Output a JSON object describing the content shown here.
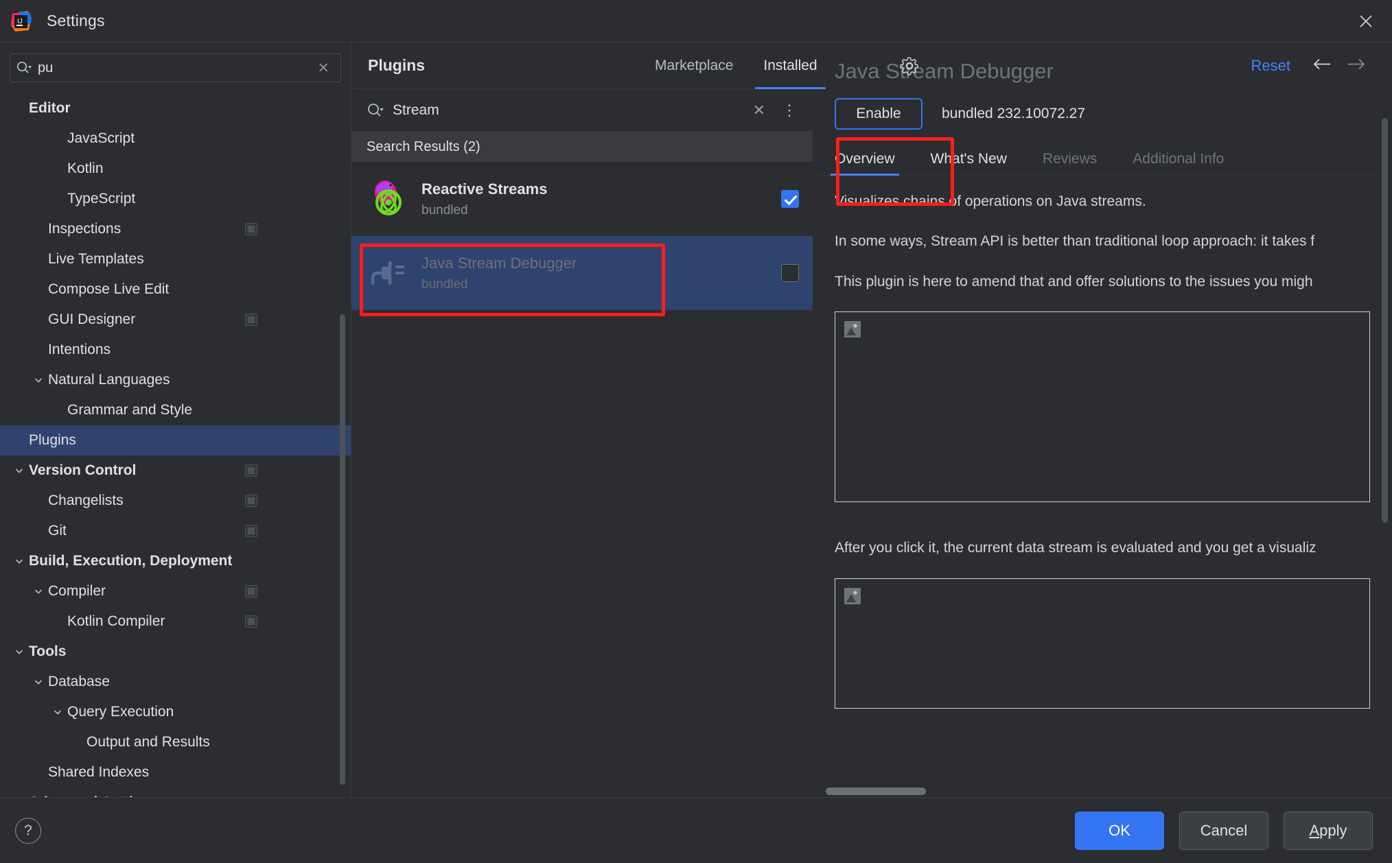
{
  "window": {
    "title": "Settings",
    "close_icon": "close-icon",
    "logo_icon": "intellij-idea-logo"
  },
  "settings_search": {
    "value": "pu",
    "placeholder": "",
    "search_icon": "search-icon",
    "clear_icon": "clear-icon"
  },
  "sidebar": {
    "items": [
      {
        "label": "Editor",
        "indent": 1,
        "bold": true,
        "arrow": "none",
        "badge": false,
        "selected": false
      },
      {
        "label": "JavaScript",
        "indent": 3,
        "bold": false,
        "arrow": "none",
        "badge": false,
        "selected": false
      },
      {
        "label": "Kotlin",
        "indent": 3,
        "bold": false,
        "arrow": "none",
        "badge": false,
        "selected": false
      },
      {
        "label": "TypeScript",
        "indent": 3,
        "bold": false,
        "arrow": "none",
        "badge": false,
        "selected": false
      },
      {
        "label": "Inspections",
        "indent": 2,
        "bold": false,
        "arrow": "none",
        "badge": true,
        "selected": false
      },
      {
        "label": "Live Templates",
        "indent": 2,
        "bold": false,
        "arrow": "none",
        "badge": false,
        "selected": false
      },
      {
        "label": "Compose Live Edit",
        "indent": 2,
        "bold": false,
        "arrow": "none",
        "badge": false,
        "selected": false
      },
      {
        "label": "GUI Designer",
        "indent": 2,
        "bold": false,
        "arrow": "none",
        "badge": true,
        "selected": false
      },
      {
        "label": "Intentions",
        "indent": 2,
        "bold": false,
        "arrow": "none",
        "badge": false,
        "selected": false
      },
      {
        "label": "Natural Languages",
        "indent": 2,
        "bold": false,
        "arrow": "down",
        "badge": false,
        "selected": false
      },
      {
        "label": "Grammar and Style",
        "indent": 3,
        "bold": false,
        "arrow": "none",
        "badge": false,
        "selected": false
      },
      {
        "label": "Plugins",
        "indent": 1,
        "bold": false,
        "arrow": "none",
        "badge": false,
        "selected": true
      },
      {
        "label": "Version Control",
        "indent": 1,
        "bold": true,
        "arrow": "down",
        "badge": true,
        "selected": false
      },
      {
        "label": "Changelists",
        "indent": 2,
        "bold": false,
        "arrow": "none",
        "badge": true,
        "selected": false
      },
      {
        "label": "Git",
        "indent": 2,
        "bold": false,
        "arrow": "none",
        "badge": true,
        "selected": false
      },
      {
        "label": "Build, Execution, Deployment",
        "indent": 1,
        "bold": true,
        "arrow": "down",
        "badge": false,
        "selected": false
      },
      {
        "label": "Compiler",
        "indent": 2,
        "bold": false,
        "arrow": "down",
        "badge": true,
        "selected": false
      },
      {
        "label": "Kotlin Compiler",
        "indent": 3,
        "bold": false,
        "arrow": "none",
        "badge": true,
        "selected": false
      },
      {
        "label": "Tools",
        "indent": 1,
        "bold": true,
        "arrow": "down",
        "badge": false,
        "selected": false
      },
      {
        "label": "Database",
        "indent": 2,
        "bold": false,
        "arrow": "down",
        "badge": false,
        "selected": false
      },
      {
        "label": "Query Execution",
        "indent": 3,
        "bold": false,
        "arrow": "down",
        "badge": false,
        "selected": false
      },
      {
        "label": "Output and Results",
        "indent": 4,
        "bold": false,
        "arrow": "none",
        "badge": false,
        "selected": false
      },
      {
        "label": "Shared Indexes",
        "indent": 2,
        "bold": false,
        "arrow": "none",
        "badge": false,
        "selected": false
      },
      {
        "label": "Advanced Settings",
        "indent": 1,
        "bold": true,
        "arrow": "none",
        "badge": false,
        "selected": false
      }
    ]
  },
  "plugins_panel": {
    "title": "Plugins",
    "tabs": [
      {
        "label": "Marketplace",
        "active": false
      },
      {
        "label": "Installed",
        "active": true
      }
    ],
    "gear_icon": "gear-icon",
    "reset_label": "Reset",
    "back_icon": "arrow-left-icon",
    "forward_icon": "arrow-right-icon",
    "search": {
      "value": "Stream",
      "search_icon": "search-icon",
      "clear_icon": "clear-icon",
      "more_icon": "more-options-icon"
    },
    "results_header": "Search Results (2)",
    "rows": [
      {
        "name": "Reactive Streams",
        "sub": "bundled",
        "checked": true,
        "selected": false,
        "disabled": false,
        "icon": "reactive-streams-icon"
      },
      {
        "name": "Java Stream Debugger",
        "sub": "bundled",
        "checked": false,
        "selected": true,
        "disabled": true,
        "icon": "plugin-plug-icon"
      }
    ]
  },
  "detail": {
    "title": "Java Stream Debugger",
    "enable_label": "Enable",
    "version_text": "bundled 232.10072.27",
    "tabs": [
      {
        "label": "Overview",
        "active": true,
        "dim": false
      },
      {
        "label": "What's New",
        "active": false,
        "dim": false
      },
      {
        "label": "Reviews",
        "active": false,
        "dim": true
      },
      {
        "label": "Additional Info",
        "active": false,
        "dim": true
      }
    ],
    "paragraphs": [
      "Visualizes chains of operations on Java streams.",
      "In some ways, Stream API is better than traditional loop approach: it takes f",
      "This plugin is here to amend that and offer solutions to the issues you migh"
    ],
    "paragraph_after_image": "After you click it, the current data stream is evaluated and you get a visualiz",
    "image_placeholder_icon": "image-placeholder-icon"
  },
  "footer": {
    "help_label": "?",
    "ok_label": "OK",
    "cancel_label": "Cancel",
    "apply_label_prefix": "A",
    "apply_label_rest": "pply"
  },
  "colors": {
    "accent_blue": "#3574f0",
    "selection_blue": "#2e436e",
    "link_blue": "#4682fa",
    "annotation_red": "#ff1d1d",
    "background": "#2b2d30",
    "panel_header": "#393b40"
  }
}
